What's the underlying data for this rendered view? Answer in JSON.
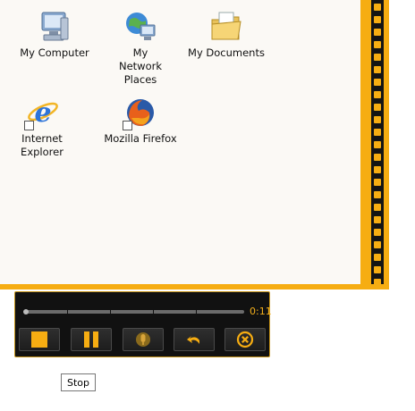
{
  "desktop": {
    "icons": [
      {
        "label": "My Computer"
      },
      {
        "label": "My Network Places"
      },
      {
        "label": "My Documents"
      },
      {
        "label": "Internet Explorer"
      },
      {
        "label": "Mozilla Firefox"
      }
    ]
  },
  "recorder": {
    "time": "0:11",
    "progress_fraction": 0.0,
    "buttons": [
      {
        "icon": "stop-icon"
      },
      {
        "icon": "pause-icon"
      },
      {
        "icon": "microphone-icon"
      },
      {
        "icon": "undo-icon"
      },
      {
        "icon": "cancel-icon"
      }
    ],
    "accent_color": "#f6ad12"
  },
  "tooltip": {
    "text": "Stop"
  }
}
